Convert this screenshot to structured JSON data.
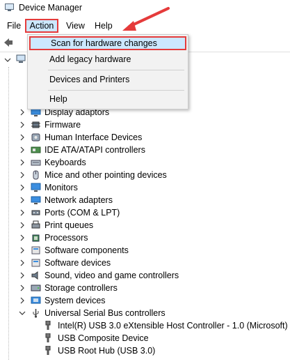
{
  "window": {
    "title": "Device Manager"
  },
  "menubar": {
    "items": [
      "File",
      "Action",
      "View",
      "Help"
    ]
  },
  "action_menu": {
    "items": [
      "Scan for hardware changes",
      "Add legacy hardware",
      "Devices and Printers",
      "Help"
    ]
  },
  "tree": {
    "categories": [
      {
        "label": "Display adaptors",
        "icon": "monitor-icon"
      },
      {
        "label": "Firmware",
        "icon": "chip-icon"
      },
      {
        "label": "Human Interface Devices",
        "icon": "hid-icon"
      },
      {
        "label": "IDE ATA/ATAPI controllers",
        "icon": "ide-icon"
      },
      {
        "label": "Keyboards",
        "icon": "keyboard-icon"
      },
      {
        "label": "Mice and other pointing devices",
        "icon": "mouse-icon"
      },
      {
        "label": "Monitors",
        "icon": "monitor-icon"
      },
      {
        "label": "Network adapters",
        "icon": "network-icon"
      },
      {
        "label": "Ports (COM & LPT)",
        "icon": "port-icon"
      },
      {
        "label": "Print queues",
        "icon": "printer-icon"
      },
      {
        "label": "Processors",
        "icon": "cpu-icon"
      },
      {
        "label": "Software components",
        "icon": "software-icon"
      },
      {
        "label": "Software devices",
        "icon": "software-icon"
      },
      {
        "label": "Sound, video and game controllers",
        "icon": "speaker-icon"
      },
      {
        "label": "Storage controllers",
        "icon": "storage-icon"
      },
      {
        "label": "System devices",
        "icon": "system-icon"
      },
      {
        "label": "Universal Serial Bus controllers",
        "icon": "usb-icon"
      }
    ],
    "usb_children": [
      "Intel(R) USB 3.0 eXtensible Host Controller - 1.0 (Microsoft)",
      "USB Composite Device",
      "USB Root Hub (USB 3.0)"
    ]
  },
  "colors": {
    "highlight": "#cce8ff",
    "annotation_red": "#e53b3b"
  }
}
